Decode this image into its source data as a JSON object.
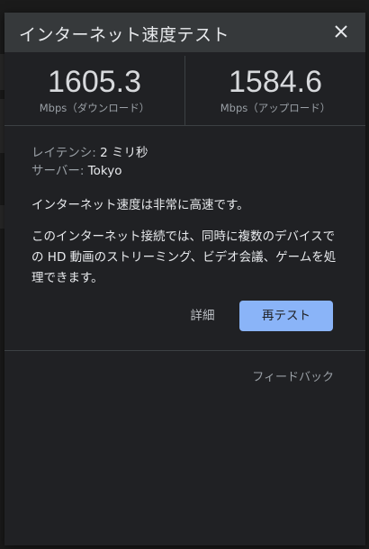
{
  "dialog": {
    "title": "インターネット速度テスト",
    "close_icon": "close-icon"
  },
  "speeds": {
    "download": {
      "value": "1605.3",
      "unit": "Mbps（ダウンロード）"
    },
    "upload": {
      "value": "1584.6",
      "unit": "Mbps（アップロード）"
    }
  },
  "details": {
    "latency_label": "レイテンシ: ",
    "latency_value": "2 ミリ秒",
    "server_label": "サーバー: ",
    "server_value": "Tokyo",
    "summary": "インターネット速度は非常に高速です。",
    "description": "このインターネット接続では、同時に複数のデバイスでの HD 動画のストリーミング、ビデオ会議、ゲームを処理できます。"
  },
  "actions": {
    "details_label": "詳細",
    "retest_label": "再テスト",
    "feedback_label": "フィードバック"
  },
  "colors": {
    "accent": "#8ab4f8",
    "surface": "#202124",
    "titlebar": "#36393b"
  }
}
